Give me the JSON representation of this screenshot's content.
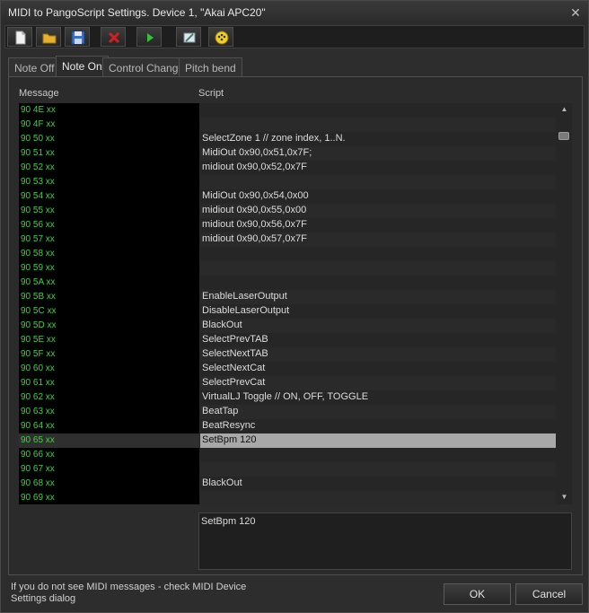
{
  "window": {
    "title": "MIDI to PangoScript Settings. Device 1, \"Akai APC20\"",
    "close": "✕"
  },
  "toolbar": {
    "buttons": [
      {
        "name": "new-icon"
      },
      {
        "name": "open-folder-icon"
      },
      {
        "name": "save-disk-icon"
      },
      {
        "name": "delete-x-icon"
      },
      {
        "name": "play-icon"
      },
      {
        "name": "edit-script-icon"
      },
      {
        "name": "midi-device-icon"
      }
    ]
  },
  "tabs": [
    "Note Off",
    "Note On",
    "Control Change",
    "Pitch bend"
  ],
  "active_tab": "Note On",
  "columns": {
    "message": "Message",
    "script": "Script"
  },
  "rows": [
    {
      "msg": "90 4E xx",
      "script": ""
    },
    {
      "msg": "90 4F xx",
      "script": ""
    },
    {
      "msg": "90 50 xx",
      "script": "SelectZone 1 // zone index, 1..N."
    },
    {
      "msg": "90 51 xx",
      "script": "MidiOut 0x90,0x51,0x7F;"
    },
    {
      "msg": "90 52 xx",
      "script": "midiout 0x90,0x52,0x7F"
    },
    {
      "msg": "90 53 xx",
      "script": ""
    },
    {
      "msg": "90 54 xx",
      "script": "MidiOut 0x90,0x54,0x00"
    },
    {
      "msg": "90 55 xx",
      "script": "midiout 0x90,0x55,0x00"
    },
    {
      "msg": "90 56 xx",
      "script": "midiout 0x90,0x56,0x7F"
    },
    {
      "msg": "90 57 xx",
      "script": "midiout 0x90,0x57,0x7F"
    },
    {
      "msg": "90 58 xx",
      "script": ""
    },
    {
      "msg": "90 59 xx",
      "script": ""
    },
    {
      "msg": "90 5A xx",
      "script": ""
    },
    {
      "msg": "90 5B xx",
      "script": "EnableLaserOutput"
    },
    {
      "msg": "90 5C xx",
      "script": "DisableLaserOutput"
    },
    {
      "msg": "90 5D xx",
      "script": "BlackOut"
    },
    {
      "msg": "90 5E xx",
      "script": "SelectPrevTAB"
    },
    {
      "msg": "90 5F xx",
      "script": "SelectNextTAB"
    },
    {
      "msg": "90 60 xx",
      "script": "SelectNextCat"
    },
    {
      "msg": "90 61 xx",
      "script": "SelectPrevCat"
    },
    {
      "msg": "90 62 xx",
      "script": "VirtualLJ Toggle // ON, OFF, TOGGLE"
    },
    {
      "msg": "90 63 xx",
      "script": "BeatTap"
    },
    {
      "msg": "90 64 xx",
      "script": "BeatResync"
    },
    {
      "msg": "90 65 xx",
      "script": "SetBpm 120",
      "selected": true
    },
    {
      "msg": "90 66 xx",
      "script": ""
    },
    {
      "msg": "90 67 xx",
      "script": ""
    },
    {
      "msg": "90 68 xx",
      "script": "BlackOut"
    },
    {
      "msg": "90 69 xx",
      "script": ""
    }
  ],
  "editor": {
    "text": "SetBpm 120"
  },
  "hint": "If you do not see MIDI messages - check MIDI Device Settings dialog",
  "buttons": {
    "ok": "OK",
    "cancel": "Cancel"
  },
  "colors": {
    "message_text": "#3fd23f",
    "selection": "#a8a8a8"
  }
}
